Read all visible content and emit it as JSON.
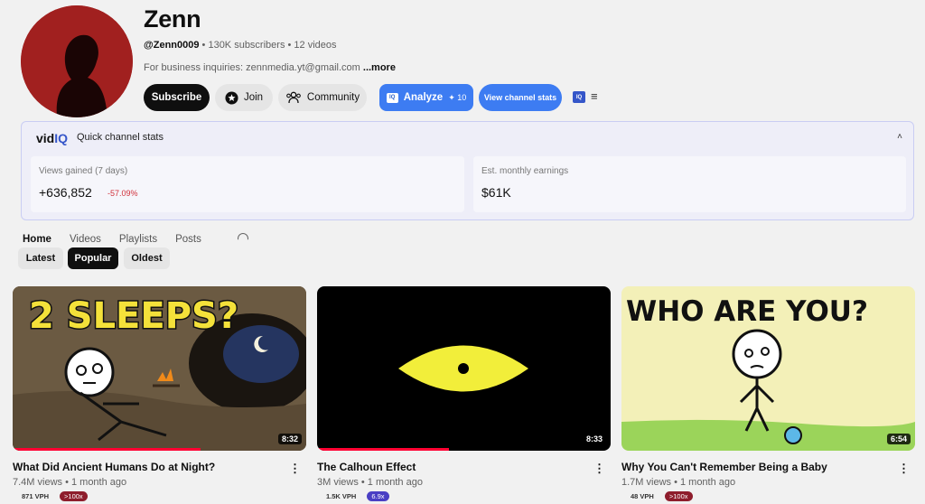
{
  "channel": {
    "name": "Zenn",
    "handle": "@Zenn0009",
    "subscribers": "• 130K subscribers • 12 videos",
    "description": "For business inquiries: zennmedia.yt@gmail.com",
    "more": "...more"
  },
  "buttons": {
    "subscribe": "Subscribe",
    "join": "Join",
    "community": "Community",
    "analyze": "Analyze",
    "analyze_count": "10",
    "view_stats": "View channel stats"
  },
  "vidiq": {
    "logo_prefix": "vid",
    "logo_suffix": "IQ",
    "badge": "IQ",
    "title": "Quick channel stats",
    "views_label": "Views gained (7 days)",
    "views_value": "+636,852",
    "views_delta": "-57.09%",
    "earnings_label": "Est. monthly earnings",
    "earnings_value": "$61K"
  },
  "tabs": [
    "Home",
    "Videos",
    "Playlists",
    "Posts"
  ],
  "chips": [
    "Latest",
    "Popular",
    "Oldest"
  ],
  "videos": [
    {
      "title": "What Did Ancient Humans Do at Night?",
      "meta": "7.4M views • 1 month ago",
      "duration": "8:32",
      "vph": "871 VPH",
      "outlier": ">100x",
      "thumb_text": "2 SLEEPS?",
      "progress": 0.64
    },
    {
      "title": "The Calhoun Effect",
      "meta": "3M views • 1 month ago",
      "duration": "8:33",
      "vph": "1.5K VPH",
      "outlier": "6.9x",
      "thumb_text": "",
      "progress": 0.45
    },
    {
      "title": "Why You Can't Remember Being a Baby",
      "meta": "1.7M views • 1 month ago",
      "duration": "6:54",
      "vph": "48 VPH",
      "outlier": ">100x",
      "thumb_text": "WHO ARE YOU?",
      "progress": 0
    }
  ],
  "colors": {
    "accent": "#3d7cf2",
    "outlier_red": "#8e1d2c",
    "outlier_blue": "#4a3fc4",
    "progress": "#ff0033"
  },
  "icons": [
    "star-icon",
    "people-icon",
    "sparkle-icon",
    "more-vert-icon",
    "menu-icon",
    "chevron-up-icon",
    "search-icon"
  ]
}
